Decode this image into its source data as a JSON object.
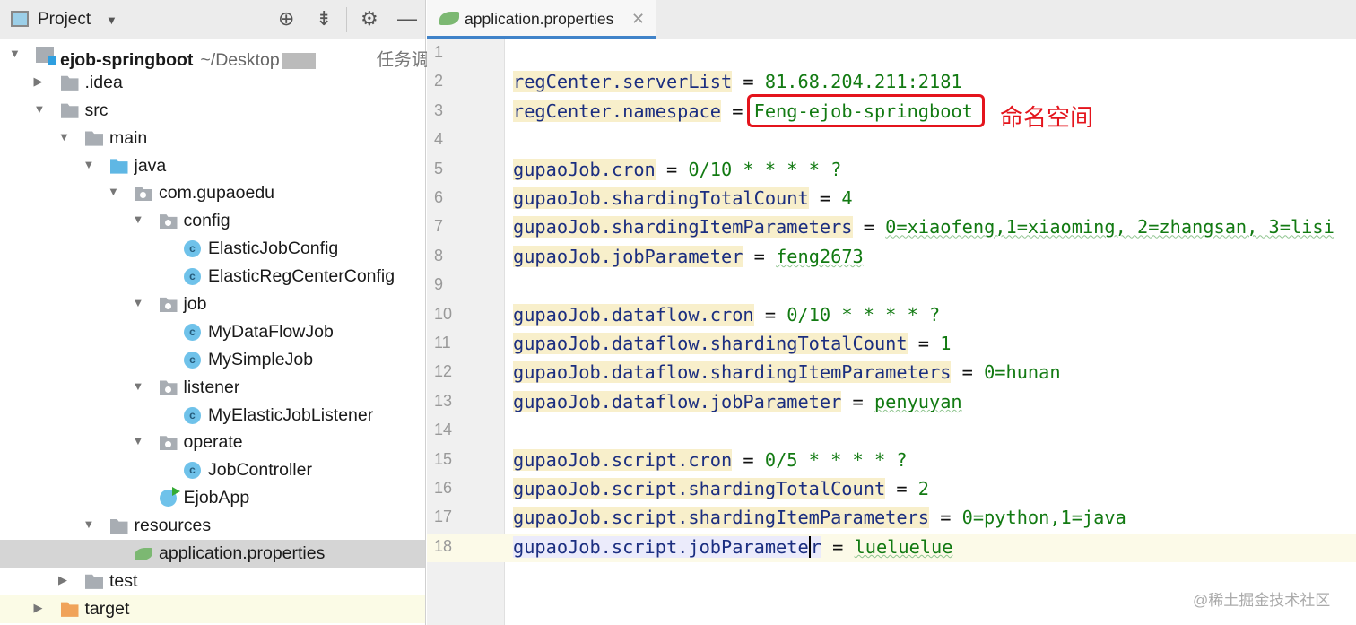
{
  "sidebar": {
    "title": "Project",
    "tree": [
      {
        "label": "ejob-springboot",
        "level": 0,
        "arrow": "open",
        "icon": "module",
        "bold": true,
        "path": "~/Desktop",
        "cjk": "任务调"
      },
      {
        "label": ".idea",
        "level": 1,
        "arrow": "closed",
        "icon": "folder"
      },
      {
        "label": "src",
        "level": 1,
        "arrow": "open",
        "icon": "folder"
      },
      {
        "label": "main",
        "level": 2,
        "arrow": "open",
        "icon": "folder"
      },
      {
        "label": "java",
        "level": 3,
        "arrow": "open",
        "icon": "blue"
      },
      {
        "label": "com.gupaoedu",
        "level": 4,
        "arrow": "open",
        "icon": "package"
      },
      {
        "label": "config",
        "level": 5,
        "arrow": "open",
        "icon": "package"
      },
      {
        "label": "ElasticJobConfig",
        "level": 6,
        "arrow": "none",
        "icon": "class"
      },
      {
        "label": "ElasticRegCenterConfig",
        "level": 6,
        "arrow": "none",
        "icon": "class"
      },
      {
        "label": "job",
        "level": 5,
        "arrow": "open",
        "icon": "package"
      },
      {
        "label": "MyDataFlowJob",
        "level": 6,
        "arrow": "none",
        "icon": "class"
      },
      {
        "label": "MySimpleJob",
        "level": 6,
        "arrow": "none",
        "icon": "class"
      },
      {
        "label": "listener",
        "level": 5,
        "arrow": "open",
        "icon": "package"
      },
      {
        "label": "MyElasticJobListener",
        "level": 6,
        "arrow": "none",
        "icon": "class"
      },
      {
        "label": "operate",
        "level": 5,
        "arrow": "open",
        "icon": "package"
      },
      {
        "label": "JobController",
        "level": 6,
        "arrow": "none",
        "icon": "class"
      },
      {
        "label": "EjobApp",
        "level": 5,
        "arrow": "none",
        "icon": "app"
      },
      {
        "label": "resources",
        "level": 3,
        "arrow": "open",
        "icon": "res"
      },
      {
        "label": "application.properties",
        "level": 4,
        "arrow": "none",
        "icon": "spring",
        "selected": true
      },
      {
        "label": "test",
        "level": 2,
        "arrow": "closed",
        "icon": "folder"
      },
      {
        "label": "target",
        "level": 1,
        "arrow": "closed",
        "icon": "orange",
        "highlight": true
      }
    ]
  },
  "editor": {
    "tab": "application.properties",
    "current_line": 18,
    "lines": [
      {
        "key": "",
        "value": ""
      },
      {
        "key": "regCenter.serverList",
        "value": "81.68.204.211:2181"
      },
      {
        "key": "regCenter.namespace",
        "value": "Feng-ejob-springboot"
      },
      {
        "key": "",
        "value": ""
      },
      {
        "key": "gupaoJob.cron",
        "value": "0/10 * * * * ?"
      },
      {
        "key": "gupaoJob.shardingTotalCount",
        "value": "4"
      },
      {
        "key": "gupaoJob.shardingItemParameters",
        "value": "0=xiaofeng,1=xiaoming, 2=zhangsan, 3=lisi",
        "squiggle": true
      },
      {
        "key": "gupaoJob.jobParameter",
        "value": "feng2673",
        "squiggle": true
      },
      {
        "key": "",
        "value": ""
      },
      {
        "key": "gupaoJob.dataflow.cron",
        "value": "0/10 * * * * ?"
      },
      {
        "key": "gupaoJob.dataflow.shardingTotalCount",
        "value": "1"
      },
      {
        "key": "gupaoJob.dataflow.shardingItemParameters",
        "value": "0=hunan"
      },
      {
        "key": "gupaoJob.dataflow.jobParameter",
        "value": "penyuyan",
        "squiggle": true
      },
      {
        "key": "",
        "value": ""
      },
      {
        "key": "gupaoJob.script.cron",
        "value": "0/5 * * * * ?"
      },
      {
        "key": "gupaoJob.script.shardingTotalCount",
        "value": "2"
      },
      {
        "key": "gupaoJob.script.shardingItemParameters",
        "value": "0=python,1=java"
      },
      {
        "key": "gupaoJob.script.jobParameter",
        "value": "lueluelue",
        "squiggle": true
      }
    ]
  },
  "annotation": {
    "label": "命名空间",
    "color": "#e4141c"
  },
  "watermark": "@稀土掘金技术社区"
}
